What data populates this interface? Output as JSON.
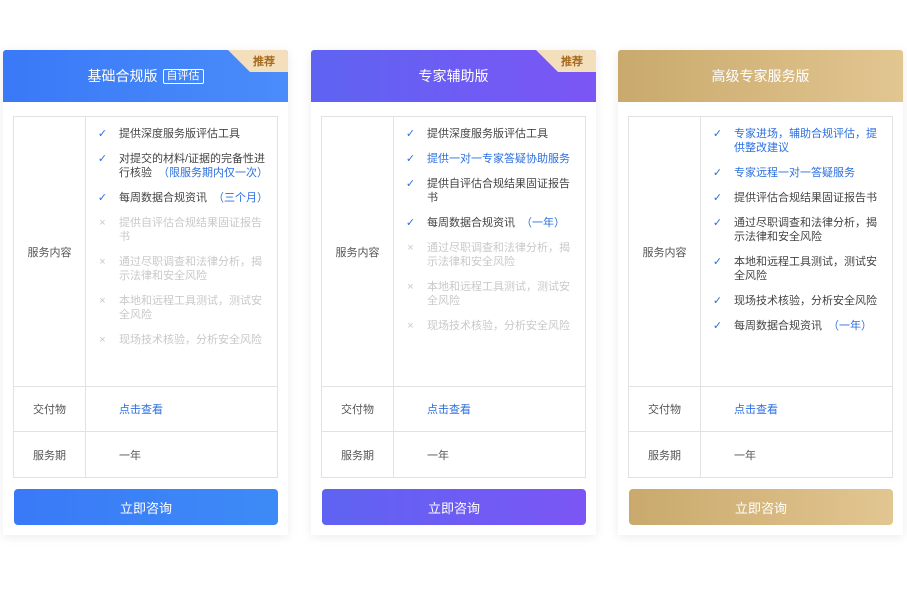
{
  "plans": [
    {
      "title": "基础合规版",
      "tag": "自评估",
      "ribbon": "推荐",
      "content_label": "服务内容",
      "features": [
        {
          "text": "提供深度服务版评估工具",
          "state": "on"
        },
        {
          "text": "对提交的材料/证据的完备性进行核验",
          "highlight": "（限服务期内仅一次）",
          "state": "on"
        },
        {
          "text": "每周数据合规资讯",
          "highlight": "（三个月）",
          "state": "on"
        },
        {
          "text": "提供自评估合规结果固证报告书",
          "state": "off"
        },
        {
          "text": "通过尽职调查和法律分析，揭示法律和安全风险",
          "state": "off"
        },
        {
          "text": "本地和远程工具测试，测试安全风险",
          "state": "off"
        },
        {
          "text": "现场技术核验，分析安全风险",
          "state": "off"
        }
      ],
      "deliver_label": "交付物",
      "deliver_value": "点击查看",
      "period_label": "服务期",
      "period_value": "一年",
      "cta": "立即咨询"
    },
    {
      "title": "专家辅助版",
      "ribbon": "推荐",
      "content_label": "服务内容",
      "features": [
        {
          "text": "提供深度服务版评估工具",
          "state": "on"
        },
        {
          "text": "提供一对一专家答疑协助服务",
          "state": "on-blue"
        },
        {
          "text": "提供自评估合规结果固证报告书",
          "state": "on"
        },
        {
          "text": "每周数据合规资讯",
          "highlight": "（一年）",
          "state": "on"
        },
        {
          "text": "通过尽职调查和法律分析，揭示法律和安全风险",
          "state": "off"
        },
        {
          "text": "本地和远程工具测试，测试安全风险",
          "state": "off"
        },
        {
          "text": "现场技术核验，分析安全风险",
          "state": "off"
        }
      ],
      "deliver_label": "交付物",
      "deliver_value": "点击查看",
      "period_label": "服务期",
      "period_value": "一年",
      "cta": "立即咨询"
    },
    {
      "title": "高级专家服务版",
      "content_label": "服务内容",
      "features": [
        {
          "text": "专家进场，辅助合规评估，提供整改建议",
          "state": "on-blue"
        },
        {
          "text": "专家远程一对一答疑服务",
          "state": "on-blue"
        },
        {
          "text": "提供评估合规结果固证报告书",
          "state": "on"
        },
        {
          "text": "通过尽职调查和法律分析，揭示法律和安全风险",
          "state": "on"
        },
        {
          "text": "本地和远程工具测试，测试安全风险",
          "state": "on"
        },
        {
          "text": "现场技术核验，分析安全风险",
          "state": "on"
        },
        {
          "text": "每周数据合规资讯",
          "highlight": "（一年）",
          "state": "on"
        }
      ],
      "deliver_label": "交付物",
      "deliver_value": "点击查看",
      "period_label": "服务期",
      "period_value": "一年",
      "cta": "立即咨询"
    }
  ],
  "colors": {
    "basic": "#3a79f7",
    "expert": "#6a5cf4",
    "premium": "#d4b47a",
    "link": "#2c6fe0"
  },
  "icons": {
    "check": "check-icon",
    "cross": "cross-icon"
  }
}
